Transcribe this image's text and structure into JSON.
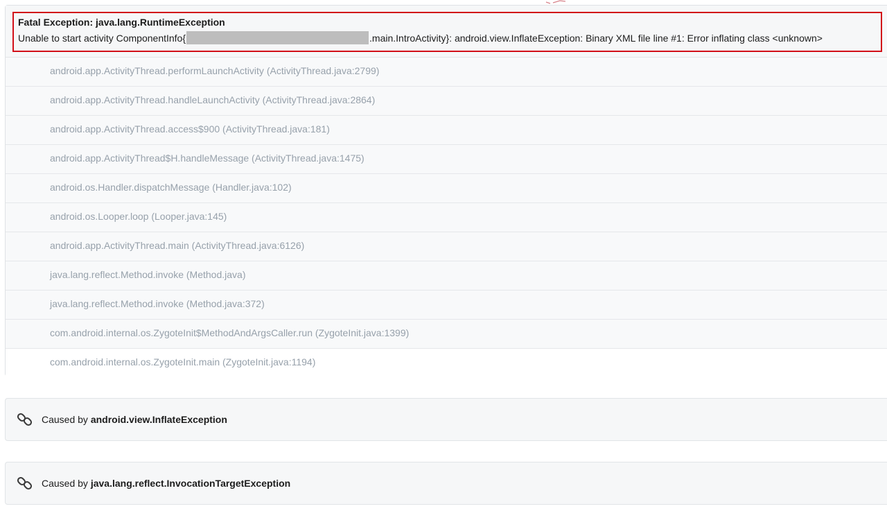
{
  "exception": {
    "title": "Fatal Exception: java.lang.RuntimeException",
    "message_prefix": "Unable to start activity ComponentInfo{",
    "message_suffix": ".main.IntroActivity}: android.view.InflateException: Binary XML file line #1: Error inflating class <unknown>"
  },
  "frames": [
    "android.app.ActivityThread.performLaunchActivity (ActivityThread.java:2799)",
    "android.app.ActivityThread.handleLaunchActivity (ActivityThread.java:2864)",
    "android.app.ActivityThread.access$900 (ActivityThread.java:181)",
    "android.app.ActivityThread$H.handleMessage (ActivityThread.java:1475)",
    "android.os.Handler.dispatchMessage (Handler.java:102)",
    "android.os.Looper.loop (Looper.java:145)",
    "android.app.ActivityThread.main (ActivityThread.java:6126)",
    "java.lang.reflect.Method.invoke (Method.java)",
    "java.lang.reflect.Method.invoke (Method.java:372)",
    "com.android.internal.os.ZygoteInit$MethodAndArgsCaller.run (ZygoteInit.java:1399)",
    "com.android.internal.os.ZygoteInit.main (ZygoteInit.java:1194)"
  ],
  "causes": [
    {
      "prefix": "Caused by",
      "name": "android.view.InflateException",
      "icon": "link-icon"
    },
    {
      "prefix": "Caused by",
      "name": "java.lang.reflect.InvocationTargetException",
      "icon": "link-icon"
    }
  ],
  "colors": {
    "highlight": "#d20f18",
    "frame_text": "#97a1ab",
    "header_bg": "#f6f7f8"
  }
}
